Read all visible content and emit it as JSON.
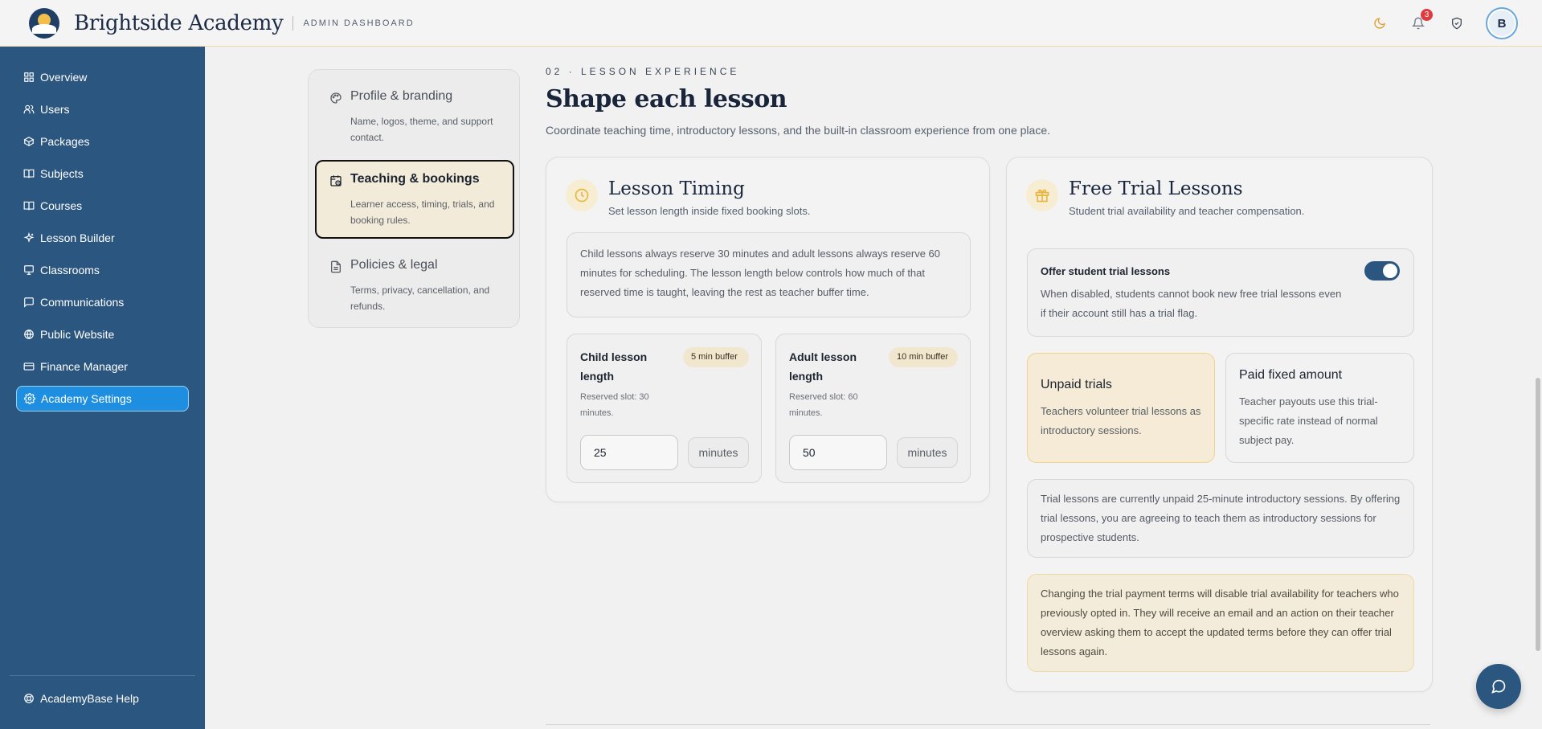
{
  "header": {
    "brand_title": "Brightside Academy",
    "brand_subtitle": "ADMIN DASHBOARD",
    "notification_count": "3",
    "avatar_initial": "B"
  },
  "sidebar": {
    "items": [
      {
        "label": "Overview",
        "icon": "grid-icon"
      },
      {
        "label": "Users",
        "icon": "users-icon"
      },
      {
        "label": "Packages",
        "icon": "box-icon"
      },
      {
        "label": "Subjects",
        "icon": "book-icon"
      },
      {
        "label": "Courses",
        "icon": "open-book-icon"
      },
      {
        "label": "Lesson Builder",
        "icon": "sparkle-icon"
      },
      {
        "label": "Classrooms",
        "icon": "presentation-icon"
      },
      {
        "label": "Communications",
        "icon": "message-icon"
      },
      {
        "label": "Public Website",
        "icon": "globe-icon"
      },
      {
        "label": "Finance Manager",
        "icon": "card-icon"
      },
      {
        "label": "Academy Settings",
        "icon": "gear-icon",
        "active": true
      }
    ],
    "help_label": "AcademyBase Help"
  },
  "settings_menu": [
    {
      "title": "Profile & branding",
      "desc": "Name, logos, theme, and support contact."
    },
    {
      "title": "Teaching & bookings",
      "desc": "Learner access, timing, trials, and booking rules.",
      "active": true
    },
    {
      "title": "Policies & legal",
      "desc": "Terms, privacy, cancellation, and refunds."
    }
  ],
  "main": {
    "eyebrow": "02 · LESSON EXPERIENCE",
    "title": "Shape each lesson",
    "lead": "Coordinate teaching time, introductory lessons, and the built-in classroom experience from one place."
  },
  "lesson_timing": {
    "title": "Lesson Timing",
    "subtitle": "Set lesson length inside fixed booking slots.",
    "info": "Child lessons always reserve 30 minutes and adult lessons always reserve 60 minutes for scheduling. The lesson length below controls how much of that reserved time is taught, leaving the rest as teacher buffer time.",
    "child": {
      "title": "Child lesson length",
      "buffer": "5 min buffer",
      "reserved": "Reserved slot: 30 minutes.",
      "value": "25",
      "unit": "minutes"
    },
    "adult": {
      "title": "Adult lesson length",
      "buffer": "10 min buffer",
      "reserved": "Reserved slot: 60 minutes.",
      "value": "50",
      "unit": "minutes"
    }
  },
  "free_trial": {
    "title": "Free Trial Lessons",
    "subtitle": "Student trial availability and teacher compensation.",
    "offer_title": "Offer student trial lessons",
    "offer_desc": "When disabled, students cannot book new free trial lessons even if their account still has a trial flag.",
    "offer_enabled": true,
    "unpaid_title": "Unpaid trials",
    "unpaid_desc": "Teachers volunteer trial lessons as introductory sessions.",
    "paid_title": "Paid fixed amount",
    "paid_desc": "Teacher payouts use this trial-specific rate instead of normal subject pay.",
    "status_info": "Trial lessons are currently unpaid 25-minute introductory sessions. By offering trial lessons, you are agreeing to teach them as introductory sessions for prospective students.",
    "warning": "Changing the trial payment terms will disable trial availability for teachers who previously opted in. They will receive an email and an action on their teacher overview asking them to accept the updated terms before they can offer trial lessons again."
  },
  "colors": {
    "sidebar": "#2b5680",
    "active_nav": "#1e8fe0",
    "accent_gold": "#f2c04a",
    "warning_bg": "#f4ecda"
  }
}
